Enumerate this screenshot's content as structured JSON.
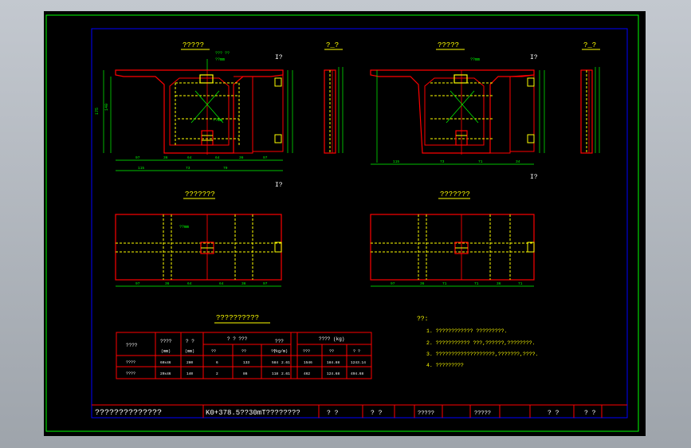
{
  "colors": {
    "background": "#000000",
    "frame_green": "#00ff00",
    "border_blue": "#0000ff",
    "concrete_red": "#ff0000",
    "rebar_yellow": "#ffff00",
    "dim_green": "#00ff00",
    "text_white": "#ffffff",
    "text_yellow": "#ffff00"
  },
  "views": {
    "elevation_left_title": "?????",
    "section_left_title": "?_?",
    "elevation_right_title": "?????",
    "section_right_title": "?_?",
    "plan_left_title": "???????",
    "plan_right_title": "???????",
    "cut_mark": "I?",
    "left_bottom_dims": [
      "115",
      "73",
      "79"
    ],
    "left_top_dims": [
      "97",
      "36",
      "64",
      "64",
      "36",
      "97"
    ],
    "right_bottom_dims": [
      "115",
      "73",
      "71",
      "34"
    ],
    "plan_left_dims": [
      "97",
      "36",
      "64",
      "64",
      "36",
      "97"
    ],
    "plan_right_dims": [
      "97",
      "36",
      "71",
      "71",
      "36",
      "71"
    ],
    "height_dims": [
      "175",
      "140"
    ],
    "callouts": [
      "??mm",
      "??? ??",
      "??mm",
      "??mm",
      "??mm"
    ]
  },
  "table": {
    "title": "??????????",
    "headers": [
      "????",
      "????",
      "? ?",
      "? ? ???",
      "???",
      "???? (kg)"
    ],
    "units": [
      "",
      "(mm)",
      "(mm)",
      "",
      "(kg/m)",
      ""
    ],
    "subheaders": [
      "??",
      "??",
      "??",
      "???",
      "??",
      "? ?"
    ],
    "rows": [
      [
        "????",
        "60x46",
        "280",
        "6",
        "133",
        "584",
        "2.61",
        "1546",
        "184.88",
        "1243.14"
      ],
      [
        "????",
        "20x46",
        "140",
        "2",
        "86",
        "118",
        "2.61",
        "462",
        "124.68",
        "494.68"
      ]
    ]
  },
  "notes": {
    "title": "??:",
    "items": [
      "1. ???????????? ?????????.",
      "2. ??????????? ???,??????,????????.",
      "3. ???????????????????,???????,????.",
      "4. ?????????"
    ]
  },
  "title_block": {
    "drawing_title": "??????????????",
    "subject": "K0+378.5??30mT????????",
    "cells": [
      "? ?",
      "? ?",
      "?????",
      "?????",
      "? ?",
      "? ?"
    ]
  }
}
